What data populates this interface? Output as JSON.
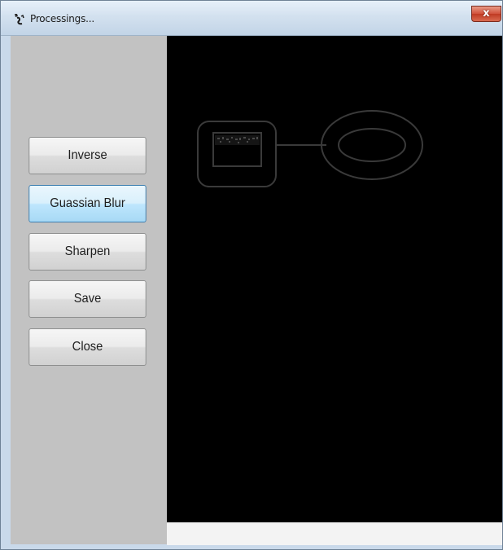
{
  "window": {
    "title": "Processings...",
    "close_label": "x"
  },
  "sidebar": {
    "buttons": [
      {
        "label": "Inverse"
      },
      {
        "label": "Guassian Blur"
      },
      {
        "label": "Sharpen"
      },
      {
        "label": "Save"
      },
      {
        "label": "Close"
      }
    ]
  },
  "colors": {
    "canvas_background": "#000000",
    "sidebar_background": "#c2c2c2",
    "focused_button_border": "#3c7fb1",
    "edge_lines": "#3a3a3a"
  },
  "icons": [
    "app-icon",
    "close-icon"
  ]
}
